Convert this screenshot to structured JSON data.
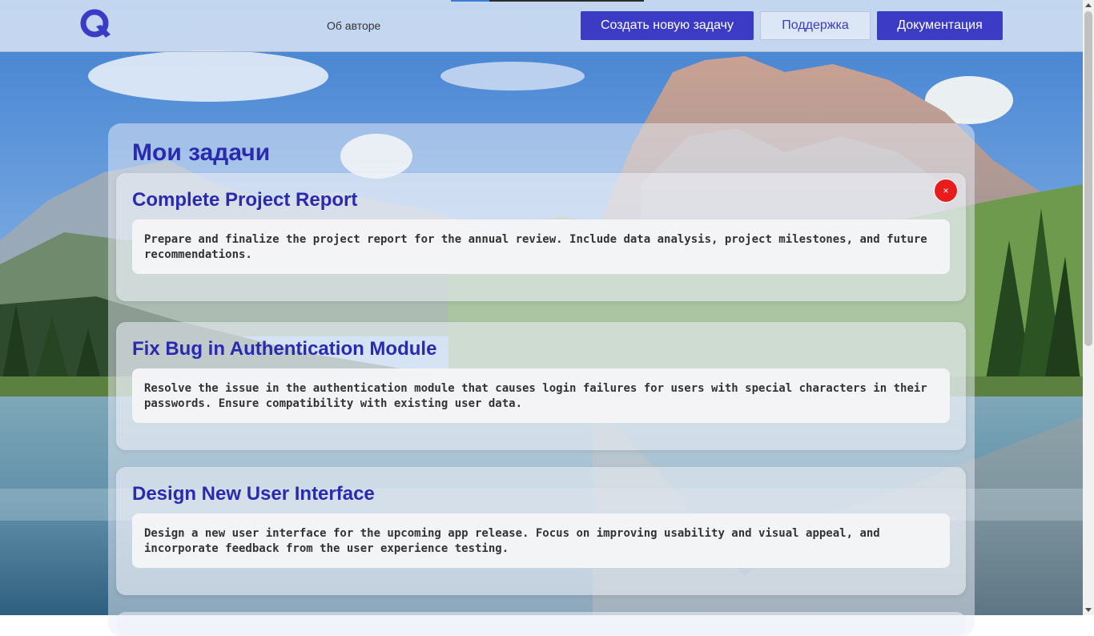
{
  "header": {
    "nav_about": "Об авторе",
    "create_task": "Создать новую задачу",
    "support": "Поддержка",
    "docs": "Документация",
    "progress": 0.2
  },
  "page": {
    "title": "Мои задачи"
  },
  "tasks": [
    {
      "title": "Complete Project Report",
      "description": "Prepare and finalize the project report for the annual review. Include data analysis, project milestones, and future recommendations."
    },
    {
      "title": "Fix Bug in Authentication Module",
      "description": "Resolve the issue in the authentication module that causes login failures for users with special characters in their passwords. Ensure compatibility with existing user data."
    },
    {
      "title": "Design New User Interface",
      "description": "Design a new user interface for the upcoming app release. Focus on improving usability and visual appeal, and incorporate feedback from the user experience testing."
    }
  ],
  "delete_label": "×",
  "icons": {
    "logo": "q-logo-icon",
    "delete": "close-icon"
  },
  "colors": {
    "accent": "#3b3bc6",
    "title": "#2a2ab0",
    "danger": "#e81c1c"
  }
}
